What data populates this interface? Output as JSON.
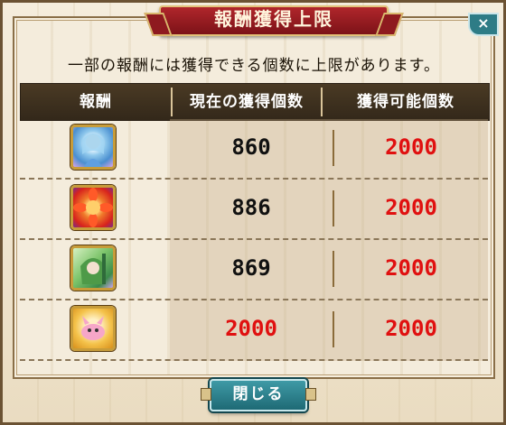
{
  "dialog": {
    "title": "報酬獲得上限",
    "close_icon": "×",
    "notice": "一部の報酬には獲得できる個数に上限があります。",
    "close_button_label": "閉じる"
  },
  "table": {
    "headers": {
      "reward": "報酬",
      "current": "現在の獲得個数",
      "max": "獲得可能個数"
    },
    "rows": [
      {
        "icon": "blue-haired-character-card-icon",
        "current": "860",
        "max": "2000",
        "current_at_limit": false
      },
      {
        "icon": "red-flower-character-card-icon",
        "current": "886",
        "max": "2000",
        "current_at_limit": false
      },
      {
        "icon": "green-hooded-character-card-icon",
        "current": "869",
        "max": "2000",
        "current_at_limit": false
      },
      {
        "icon": "pink-creature-card-icon",
        "current": "2000",
        "max": "2000",
        "current_at_limit": true
      }
    ]
  },
  "colors": {
    "value_normal": "#111111",
    "value_limit": "#e01010"
  }
}
